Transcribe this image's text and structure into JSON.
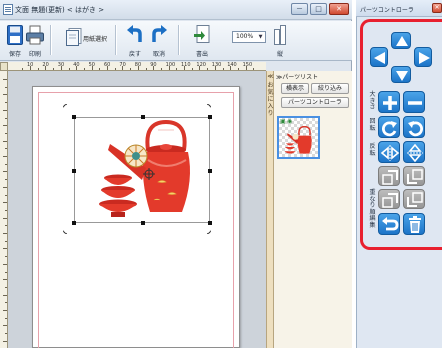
{
  "app": {
    "title": "文面  無題(更新) < はがき >",
    "window_buttons": {
      "minimize": "－",
      "maximize": "□",
      "close": "✕"
    }
  },
  "toolbar": {
    "save": "保存",
    "print": "印刷",
    "paper_select": "用紙選択",
    "undo": "戻す",
    "cancel": "取消",
    "export_pos": "書出",
    "zoom": "100%",
    "vertical": "縦"
  },
  "ruler": {
    "h_ticks": [
      "10",
      "20",
      "30",
      "40",
      "50",
      "60",
      "70",
      "80",
      "90",
      "100",
      "110",
      "120",
      "130",
      "140",
      "150"
    ]
  },
  "sidebar": {
    "collapse": "≪",
    "favorites": "お気に入り"
  },
  "parts_list": {
    "title": "≫パーツリスト",
    "horizontal_view": "横表示",
    "filter": "絞り込み",
    "controller": "パーツコントローラ"
  },
  "parts_controller": {
    "title": "パーツコントローラ",
    "close": "✕",
    "labels": {
      "size": "大きさ",
      "rotate": "回転",
      "flip": "反転",
      "order": "重なり順",
      "edit": "編集"
    }
  },
  "colors": {
    "accent_blue": "#1c74c8",
    "highlight_red": "#e8202f",
    "disabled_gray": "#979797",
    "teapot_red": "#e33a2b"
  },
  "icons": {
    "save": "floppy-disk-icon",
    "print": "printer-icon",
    "paper": "paper-select-icon",
    "undo": "undo-icon",
    "cancel": "redo-icon",
    "export": "export-icon",
    "vertical": "vertical-layout-icon"
  }
}
